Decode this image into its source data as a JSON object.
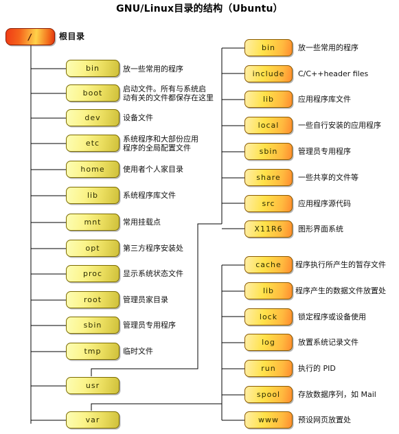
{
  "title": "GNU/Linux目录的结构（Ubuntu）",
  "root": {
    "name": "/",
    "label": "根目录"
  },
  "colors": {
    "left_node_light": "#fdfdb4",
    "left_node_dark": "#cfc03a",
    "right_node_light": "#ffe24a",
    "right_node_dark": "#ff8c2e",
    "root_node_start": "#ef3b16",
    "root_node_end": "#e03410",
    "line": "#000000",
    "text": "#101010"
  },
  "root_children": [
    {
      "name": "bin",
      "desc": "放一些常用的程序"
    },
    {
      "name": "boot",
      "desc": "启动文件。所有与系统启\n动有关的文件都保存在这里"
    },
    {
      "name": "dev",
      "desc": "设备文件"
    },
    {
      "name": "etc",
      "desc": "系统程序和大部份应用\n程序的全局配置文件"
    },
    {
      "name": "home",
      "desc": "使用者个人家目录"
    },
    {
      "name": "lib",
      "desc": "系统程序库文件"
    },
    {
      "name": "mnt",
      "desc": "常用挂载点"
    },
    {
      "name": "opt",
      "desc": "第三方程序安装处"
    },
    {
      "name": "proc",
      "desc": "显示系统状态文件"
    },
    {
      "name": "root",
      "desc": "管理员家目录"
    },
    {
      "name": "sbin",
      "desc": "管理员专用程序"
    },
    {
      "name": "tmp",
      "desc": "临时文件"
    },
    {
      "name": "usr",
      "desc": ""
    },
    {
      "name": "var",
      "desc": ""
    }
  ],
  "usr_children": [
    {
      "name": "bin",
      "desc": "放一些常用的程序"
    },
    {
      "name": "include",
      "desc": "C/C++header files"
    },
    {
      "name": "lib",
      "desc": "应用程序库文件"
    },
    {
      "name": "local",
      "desc": "一些自行安装的应用程序"
    },
    {
      "name": "sbin",
      "desc": "管理员专用程序"
    },
    {
      "name": "share",
      "desc": "一些共享的文件等"
    },
    {
      "name": "src",
      "desc": "应用程序源代码"
    },
    {
      "name": "X11R6",
      "desc": "图形界面系统"
    }
  ],
  "var_children": [
    {
      "name": "cache",
      "desc": "程序执行所产生的暂存文件"
    },
    {
      "name": "lib",
      "desc": "程序产生的数据文件放置处"
    },
    {
      "name": "lock",
      "desc": "锁定程序或设备使用"
    },
    {
      "name": "log",
      "desc": "放置系统记录文件"
    },
    {
      "name": "run",
      "desc": "执行的 PID"
    },
    {
      "name": "spool",
      "desc": "存放数据序列，如 Mail"
    },
    {
      "name": "www",
      "desc": "预设网页放置处"
    }
  ]
}
